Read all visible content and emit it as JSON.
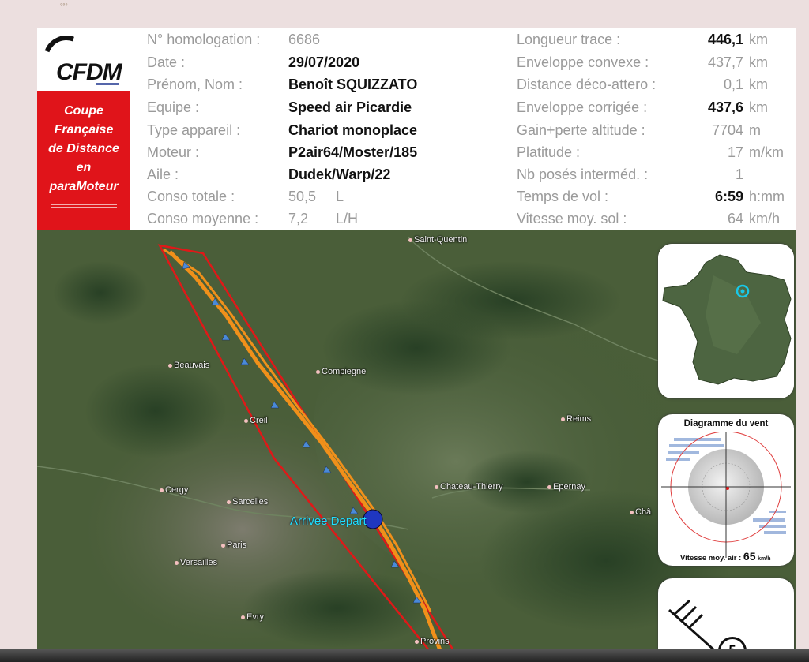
{
  "logo": {
    "text": "CFDM"
  },
  "badge": {
    "lines": [
      "Coupe",
      "Française",
      "de Distance",
      "en",
      "paraMoteur"
    ]
  },
  "left_info": [
    {
      "label": "N° homologation :",
      "value": "6686",
      "style": "grey"
    },
    {
      "label": "Date :",
      "value": "29/07/2020",
      "style": "bold"
    },
    {
      "label": "Prénom, Nom :",
      "value": "Benoît SQUIZZATO",
      "style": "bold"
    },
    {
      "label": "Equipe :",
      "value": "Speed air Picardie",
      "style": "bold"
    },
    {
      "label": "Type appareil :",
      "value": "Chariot monoplace",
      "style": "bold"
    },
    {
      "label": "Moteur :",
      "value": "P2air64/Moster/185",
      "style": "bold"
    },
    {
      "label": "Aile :",
      "value": "Dudek/Warp/22",
      "style": "bold"
    },
    {
      "label": "Conso totale :",
      "value": "50,5",
      "unit": "L",
      "style": "grey"
    },
    {
      "label": "Conso moyenne :",
      "value": "7,2",
      "unit": "L/H",
      "style": "grey"
    }
  ],
  "right_info": [
    {
      "label": "Longueur trace :",
      "value": "446,1",
      "unit": "km",
      "style": "bold"
    },
    {
      "label": "Enveloppe convexe :",
      "value": "437,7",
      "unit": "km",
      "style": "grey"
    },
    {
      "label": "Distance déco-attero :",
      "value": "0,1",
      "unit": "km",
      "style": "grey"
    },
    {
      "label": "Enveloppe corrigée :",
      "value": "437,6",
      "unit": "km",
      "style": "bold"
    },
    {
      "label": "Gain+perte altitude :",
      "value": "7704",
      "unit": "m",
      "style": "grey"
    },
    {
      "label": "Platitude :",
      "value": "17",
      "unit": "m/km",
      "style": "grey"
    },
    {
      "label": "Nb posés interméd. :",
      "value": "1",
      "unit": "",
      "style": "grey"
    },
    {
      "label": "Temps de vol :",
      "value": "6:59",
      "unit": "h:mm",
      "style": "bold"
    },
    {
      "label": "Vitesse moy. sol :",
      "value": "64",
      "unit": "km/h",
      "style": "grey"
    }
  ],
  "map": {
    "towns": [
      "Saint-Quentin",
      "Beauvais",
      "Compiegne",
      "Creil",
      "Reims",
      "Cergy",
      "Sarcelles",
      "Chateau-Thierry",
      "Epernay",
      "Châ",
      "Paris",
      "Versailles",
      "Evry",
      "Provins"
    ],
    "arrival_label": "Arrivee Depart",
    "track_color": "#f0901a",
    "envelope_color": "#e01818"
  },
  "wind_panel": {
    "title": "Diagramme du vent",
    "speed_label": "Vitesse moy. air :",
    "speed_value": "65",
    "speed_unit": "km/h"
  },
  "bottom_panel": {
    "number": "5"
  }
}
